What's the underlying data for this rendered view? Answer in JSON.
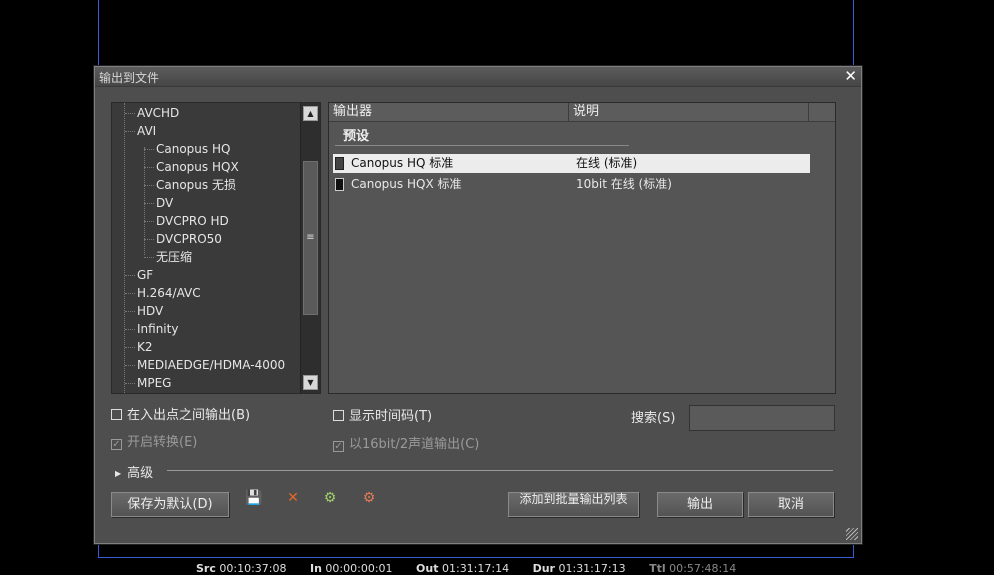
{
  "dialog": {
    "title": "输出到文件",
    "close": "✕"
  },
  "tree": {
    "items": [
      {
        "label": "AVCHD",
        "level": 0
      },
      {
        "label": "AVI",
        "level": 0
      },
      {
        "label": "Canopus HQ",
        "level": 1
      },
      {
        "label": "Canopus HQX",
        "level": 1
      },
      {
        "label": "Canopus 无损",
        "level": 1
      },
      {
        "label": "DV",
        "level": 1
      },
      {
        "label": "DVCPRO HD",
        "level": 1
      },
      {
        "label": "DVCPRO50",
        "level": 1
      },
      {
        "label": "无压缩",
        "level": 1
      },
      {
        "label": "GF",
        "level": 0
      },
      {
        "label": "H.264/AVC",
        "level": 0
      },
      {
        "label": "HDV",
        "level": 0
      },
      {
        "label": "Infinity",
        "level": 0
      },
      {
        "label": "K2",
        "level": 0
      },
      {
        "label": "MEDIAEDGE/HDMA-4000",
        "level": 0
      },
      {
        "label": "MPEG",
        "level": 0
      }
    ],
    "scroll_up": "▲",
    "scroll_down": "▼",
    "scroll_thumb": "≡"
  },
  "list": {
    "col_exporter": "输出器",
    "col_description": "说明",
    "group": "预设",
    "rows": [
      {
        "name": "Canopus HQ 标准",
        "desc": "在线 (标准)",
        "selected": true
      },
      {
        "name": "Canopus HQX 标准",
        "desc": "10bit 在线 (标准)",
        "selected": false
      }
    ]
  },
  "options": {
    "between_in_out": "在入出点之间输出(B)",
    "enable_conversion": "开启转换(E)",
    "show_timecode": "显示时间码(T)",
    "output_16bit": "以16bit/2声道输出(C)",
    "check_mark": "✓"
  },
  "search": {
    "label": "搜索(S)",
    "value": ""
  },
  "advanced": {
    "label": "高级",
    "arrow": "▶"
  },
  "buttons": {
    "save_default": "保存为默认(D)",
    "add_batch": "添加到批量输出列表",
    "export": "输出",
    "cancel": "取消"
  },
  "toolbar_icons": {
    "save": "💾",
    "delete": "✕",
    "import": "⚙",
    "export": "⚙"
  },
  "status": {
    "src_label": "Src",
    "src": "00:10:37:08",
    "in_label": "In",
    "in": "00:00:00:01",
    "out_label": "Out",
    "out": "01:31:17:14",
    "dur_label": "Dur",
    "dur": "01:31:17:13",
    "ttl_label": "Ttl",
    "ttl": "00:57:48:14"
  },
  "colors": {
    "accent_frame": "#3a5bd6",
    "delete_icon": "#e06a2a",
    "selection_bg": "#ececec"
  }
}
